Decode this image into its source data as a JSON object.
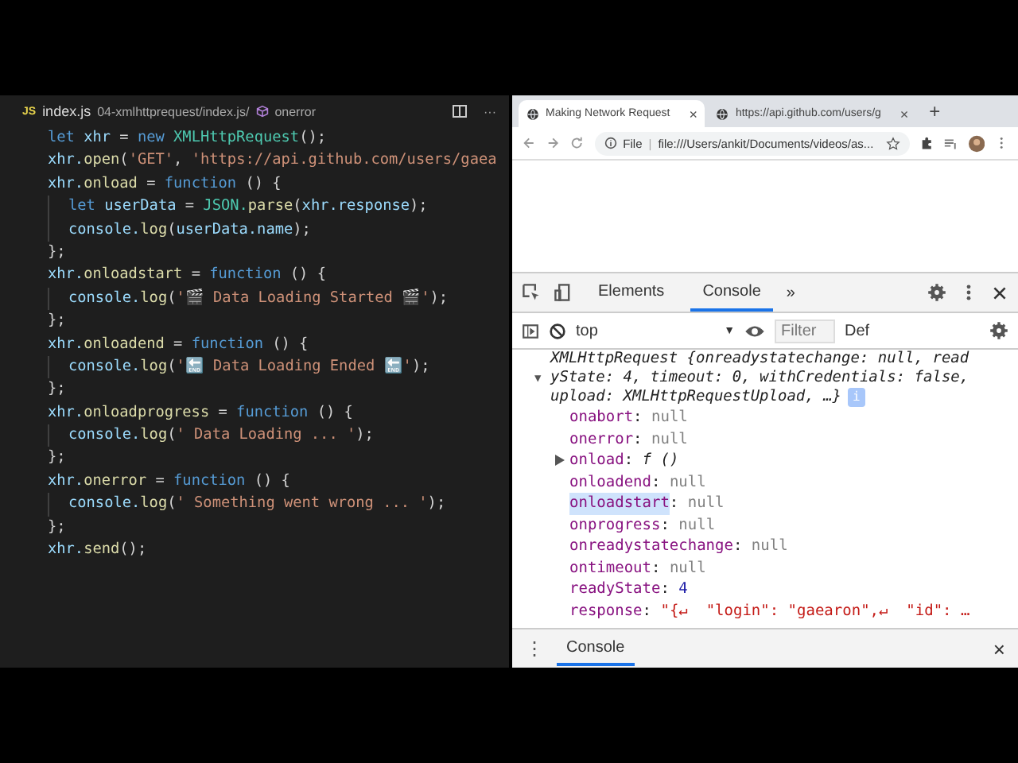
{
  "editor": {
    "breadcrumb": {
      "file_badge": "JS",
      "file": "index.js",
      "path": "04-xmlhttprequest/index.js/",
      "symbol": "onerror"
    },
    "actions": [
      "···"
    ],
    "lines": [
      {
        "indented": false,
        "tokens": [
          {
            "kind": "kw",
            "t": "let "
          },
          {
            "kind": "var",
            "t": "xhr"
          },
          {
            "kind": "plain",
            "t": " = "
          },
          {
            "kind": "kw",
            "t": "new "
          },
          {
            "kind": "cls",
            "t": "XMLHttpRequest"
          },
          {
            "kind": "plain",
            "t": "();"
          }
        ]
      },
      {
        "indented": false,
        "tokens": [
          {
            "kind": "var",
            "t": "xhr."
          },
          {
            "kind": "fn",
            "t": "open"
          },
          {
            "kind": "plain",
            "t": "("
          },
          {
            "kind": "str",
            "t": "'GET'"
          },
          {
            "kind": "plain",
            "t": ", "
          },
          {
            "kind": "str",
            "t": "'https://api.github.com/users/gaea"
          }
        ]
      },
      {
        "indented": false,
        "tokens": [
          {
            "kind": "var",
            "t": "xhr."
          },
          {
            "kind": "fn",
            "t": "onload"
          },
          {
            "kind": "plain",
            "t": " = "
          },
          {
            "kind": "kw",
            "t": "function"
          },
          {
            "kind": "plain",
            "t": " () {"
          }
        ]
      },
      {
        "indented": true,
        "tokens": [
          {
            "kind": "kw",
            "t": "let "
          },
          {
            "kind": "var",
            "t": "userData"
          },
          {
            "kind": "plain",
            "t": " = "
          },
          {
            "kind": "cls",
            "t": "JSON."
          },
          {
            "kind": "fn",
            "t": "parse"
          },
          {
            "kind": "plain",
            "t": "("
          },
          {
            "kind": "var",
            "t": "xhr.response"
          },
          {
            "kind": "plain",
            "t": ");"
          }
        ]
      },
      {
        "indented": true,
        "tokens": [
          {
            "kind": "var",
            "t": "console."
          },
          {
            "kind": "fn",
            "t": "log"
          },
          {
            "kind": "plain",
            "t": "("
          },
          {
            "kind": "var",
            "t": "userData.name"
          },
          {
            "kind": "plain",
            "t": ");"
          }
        ]
      },
      {
        "indented": false,
        "tokens": [
          {
            "kind": "plain",
            "t": "};"
          }
        ]
      },
      {
        "indented": false,
        "tokens": [
          {
            "kind": "var",
            "t": "xhr."
          },
          {
            "kind": "fn",
            "t": "onloadstart"
          },
          {
            "kind": "plain",
            "t": " = "
          },
          {
            "kind": "kw",
            "t": "function"
          },
          {
            "kind": "plain",
            "t": " () {"
          }
        ]
      },
      {
        "indented": true,
        "tokens": [
          {
            "kind": "var",
            "t": "console."
          },
          {
            "kind": "fn",
            "t": "log"
          },
          {
            "kind": "plain",
            "t": "("
          },
          {
            "kind": "str",
            "t": "'🎬 Data Loading Started 🎬'"
          },
          {
            "kind": "plain",
            "t": ");"
          }
        ]
      },
      {
        "indented": false,
        "tokens": [
          {
            "kind": "plain",
            "t": "};"
          }
        ]
      },
      {
        "indented": false,
        "tokens": [
          {
            "kind": "var",
            "t": "xhr."
          },
          {
            "kind": "fn",
            "t": "onloadend"
          },
          {
            "kind": "plain",
            "t": " = "
          },
          {
            "kind": "kw",
            "t": "function"
          },
          {
            "kind": "plain",
            "t": " () {"
          }
        ]
      },
      {
        "indented": true,
        "tokens": [
          {
            "kind": "var",
            "t": "console."
          },
          {
            "kind": "fn",
            "t": "log"
          },
          {
            "kind": "plain",
            "t": "("
          },
          {
            "kind": "str",
            "t": "'🔚 Data Loading Ended 🔚'"
          },
          {
            "kind": "plain",
            "t": ");"
          }
        ]
      },
      {
        "indented": false,
        "tokens": [
          {
            "kind": "plain",
            "t": "};"
          }
        ]
      },
      {
        "indented": false,
        "tokens": [
          {
            "kind": "var",
            "t": "xhr."
          },
          {
            "kind": "fn",
            "t": "onloadprogress"
          },
          {
            "kind": "plain",
            "t": " = "
          },
          {
            "kind": "kw",
            "t": "function"
          },
          {
            "kind": "plain",
            "t": " () {"
          }
        ]
      },
      {
        "indented": true,
        "tokens": [
          {
            "kind": "var",
            "t": "console."
          },
          {
            "kind": "fn",
            "t": "log"
          },
          {
            "kind": "plain",
            "t": "("
          },
          {
            "kind": "str",
            "t": "' Data Loading ... '"
          },
          {
            "kind": "plain",
            "t": ");"
          }
        ]
      },
      {
        "indented": false,
        "tokens": [
          {
            "kind": "plain",
            "t": "};"
          }
        ]
      },
      {
        "indented": false,
        "tokens": [
          {
            "kind": "var",
            "t": "xhr."
          },
          {
            "kind": "fn",
            "t": "onerror"
          },
          {
            "kind": "plain",
            "t": " = "
          },
          {
            "kind": "kw",
            "t": "function"
          },
          {
            "kind": "plain",
            "t": " () {"
          }
        ]
      },
      {
        "indented": true,
        "tokens": [
          {
            "kind": "var",
            "t": "console."
          },
          {
            "kind": "fn",
            "t": "log"
          },
          {
            "kind": "plain",
            "t": "("
          },
          {
            "kind": "str",
            "t": "' Something went wrong ... '"
          },
          {
            "kind": "plain",
            "t": ");"
          }
        ]
      },
      {
        "indented": false,
        "tokens": [
          {
            "kind": "plain",
            "t": "};"
          }
        ]
      },
      {
        "indented": false,
        "tokens": [
          {
            "kind": "var",
            "t": "xhr."
          },
          {
            "kind": "fn",
            "t": "send"
          },
          {
            "kind": "plain",
            "t": "();"
          }
        ]
      }
    ]
  },
  "browser": {
    "tabs": [
      {
        "label": "Making Network Request",
        "close": "×",
        "selected": true
      },
      {
        "label": "https://api.github.com/users/g",
        "close": "×",
        "selected": false
      }
    ],
    "new_tab": "+",
    "separator": "|",
    "address": {
      "scheme": "File",
      "url": "file:///Users/ankit/Documents/videos/as..."
    },
    "devtools": {
      "tabs": [
        {
          "label": "Elements",
          "selected": false
        },
        {
          "label": "Console",
          "selected": true
        }
      ],
      "more": "»",
      "context": "top",
      "caret": "▼",
      "expand": "▼",
      "colon": ":",
      "menu": "⋮",
      "filter_placeholder": "Filter",
      "levels": "Def",
      "summary": [
        "XMLHttpRequest {onreadystatechange: null, read",
        "yState: 4, timeout: 0, withCredentials: false,",
        "upload: XMLHttpRequestUpload, …}"
      ],
      "info_badge": "i",
      "props": [
        {
          "key": "onabort",
          "value": "null",
          "kind": "null",
          "expandable": false,
          "selected": false
        },
        {
          "key": "onerror",
          "value": "null",
          "kind": "null",
          "expandable": false,
          "selected": false
        },
        {
          "key": "onload",
          "value": "f ()",
          "kind": "func",
          "expandable": true,
          "selected": false
        },
        {
          "key": "onloadend",
          "value": "null",
          "kind": "null",
          "expandable": false,
          "selected": false
        },
        {
          "key": "onloadstart",
          "value": "null",
          "kind": "null",
          "expandable": false,
          "selected": true
        },
        {
          "key": "onprogress",
          "value": "null",
          "kind": "null",
          "expandable": false,
          "selected": false
        },
        {
          "key": "onreadystatechange",
          "value": "null",
          "kind": "null",
          "expandable": false,
          "selected": false
        },
        {
          "key": "ontimeout",
          "value": "null",
          "kind": "null",
          "expandable": false,
          "selected": false
        },
        {
          "key": "readyState",
          "value": "4",
          "kind": "number",
          "expandable": false,
          "selected": false
        },
        {
          "key": "response",
          "value": "\"{↵  \"login\": \"gaearon\",↵  \"id\": …",
          "kind": "string",
          "expandable": false,
          "selected": false
        }
      ],
      "drawer": {
        "tab": "Console",
        "close": "×"
      }
    }
  }
}
